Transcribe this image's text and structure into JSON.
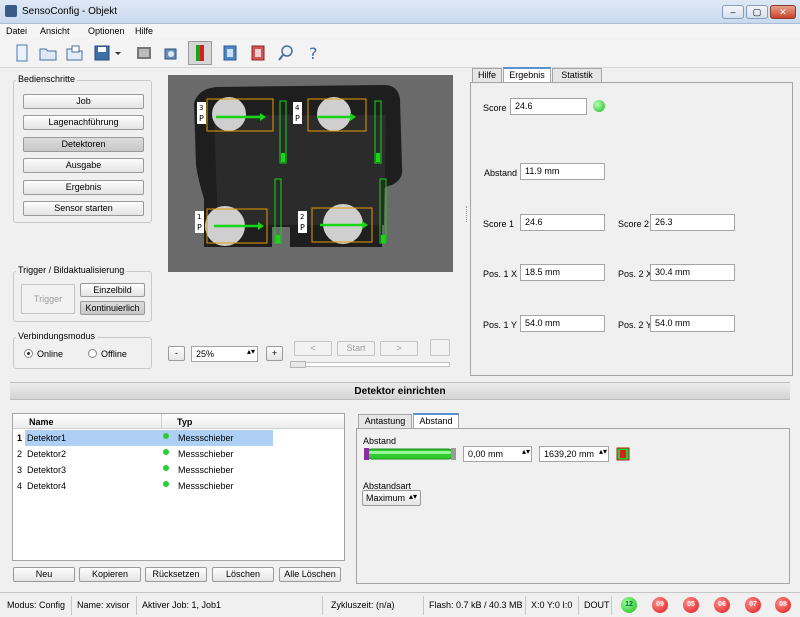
{
  "window": {
    "title": "SensoConfig - Objekt"
  },
  "menu": [
    "Datei",
    "Ansicht",
    "Optionen",
    "Hilfe"
  ],
  "toolbar_icons": [
    "new-file-icon",
    "open-folder-icon",
    "open-file-icon",
    "save-disk-icon",
    "save-dropdown-arrow-icon",
    "film-strip-icon",
    "camera-icon",
    "sensor-active-icon",
    "detector-blue-icon",
    "detector-red-icon",
    "magnifier-icon",
    "help-question-icon"
  ],
  "steps": {
    "label": "Bedienschritte",
    "buttons": [
      "Job",
      "Lagenachführung",
      "Detektoren",
      "Ausgabe",
      "Ergebnis",
      "Sensor starten"
    ]
  },
  "trigger": {
    "label": "Trigger / Bildaktualisierung",
    "trigger_btn": "Trigger",
    "single_btn": "Einzelbild",
    "continuous_btn": "Kontinuierlich"
  },
  "connection": {
    "label": "Verbindungsmodus",
    "online": "Online",
    "offline": "Offline"
  },
  "image": {
    "markers": [
      "3",
      "4",
      "1",
      "2"
    ],
    "zoom_minus": "-",
    "zoom_value": "25%",
    "zoom_plus": "+",
    "prev": "<",
    "start": "Start",
    "next": ">"
  },
  "result_panel": {
    "tabs": [
      "Hilfe",
      "Ergebnis",
      "Statistik"
    ],
    "score_label": "Score",
    "score_value": "24.6",
    "distance_label": "Abstand",
    "distance_value": "11.9 mm",
    "score1_label": "Score 1",
    "score1_value": "24.6",
    "score2_label": "Score 2",
    "score2_value": "26.3",
    "pos1x_label": "Pos. 1 X",
    "pos1x_value": "18.5 mm",
    "pos2x_label": "Pos. 2 X",
    "pos2x_value": "30.4 mm",
    "pos1y_label": "Pos. 1 Y",
    "pos1y_value": "54.0 mm",
    "pos2y_label": "Pos. 2 Y",
    "pos2y_value": "54.0 mm"
  },
  "detector_header": "Detektor einrichten",
  "detector_table": {
    "col_name": "Name",
    "col_type": "Typ",
    "rows": [
      {
        "num": "1",
        "name": "Detektor1",
        "type": "Messschieber"
      },
      {
        "num": "2",
        "name": "Detektor2",
        "type": "Messschieber"
      },
      {
        "num": "3",
        "name": "Detektor3",
        "type": "Messschieber"
      },
      {
        "num": "4",
        "name": "Detektor4",
        "type": "Messschieber"
      }
    ],
    "buttons": [
      "Neu",
      "Kopieren",
      "Rücksetzen",
      "Löschen",
      "Alle Löschen"
    ]
  },
  "settings": {
    "tabs": [
      "Antastung",
      "Abstand"
    ],
    "abstand_label": "Abstand",
    "min_value": "0,00 mm",
    "max_value": "1639,20 mm",
    "abstandsart_label": "Abstandsart",
    "abstandsart_value": "Maximum"
  },
  "status": {
    "modus": "Modus:  Config",
    "name": "Name:  xvisor",
    "job": "Aktiver Job:  1, Job1",
    "cycle": "Zykluszeit:  (n/a)",
    "flash": "Flash:  0.7 kB / 40.3 MB",
    "xyz": "X:0 Y:0 I:0",
    "dout": "DOUT",
    "leds": [
      "12",
      "09",
      "05",
      "06",
      "07",
      "08"
    ]
  },
  "colors": {
    "accent": "#5a8fd0",
    "selection": "#aed0f5",
    "ok_green": "#2fcc2f",
    "alarm_red": "#e01818",
    "overlay_orange": "#e59a00",
    "overlay_green": "#17d617"
  }
}
